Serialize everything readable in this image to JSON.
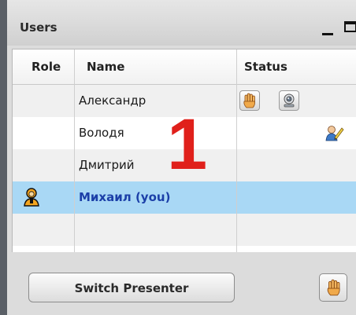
{
  "panel": {
    "title": "Users",
    "minimize_icon": "minimize-icon",
    "maximize_icon": "maximize-icon"
  },
  "table": {
    "columns": [
      "Role",
      "Name",
      "Status"
    ],
    "rows": [
      {
        "name": "Александр",
        "status_icons": [
          "raised-hand-icon",
          "webcam-icon"
        ]
      },
      {
        "name": "Володя",
        "status_icons": [
          "user-presenter-icon"
        ]
      },
      {
        "name": "Дмитрий",
        "status_icons": []
      },
      {
        "name": "Михаил (you)",
        "role_icon": "moderator-user-icon",
        "selected": true,
        "status_icons": []
      },
      {
        "name": "",
        "status_icons": []
      }
    ]
  },
  "annotation": {
    "number": "1",
    "color": "#e0201b"
  },
  "footer": {
    "switch_presenter_label": "Switch Presenter",
    "raise_hand_icon": "raised-hand-icon"
  },
  "colors": {
    "selected_row": "#a9d8f5",
    "self_name": "#1b3fa8"
  }
}
